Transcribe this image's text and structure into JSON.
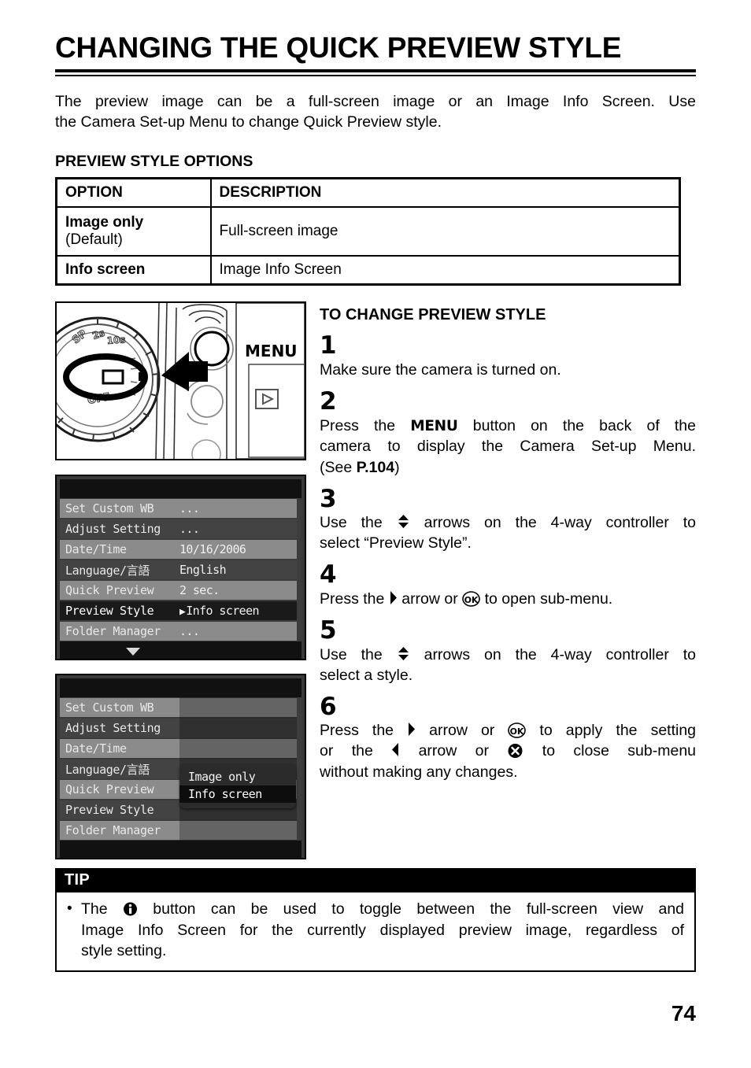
{
  "document": {
    "title": "CHANGING THE QUICK PREVIEW STYLE",
    "page_number": "74"
  },
  "intro": {
    "line1": "The preview image can be a full-screen image or an Image Info Screen.   Use",
    "line2": "the Camera Set-up Menu to change Quick Preview style."
  },
  "options_section": {
    "heading": "PREVIEW STYLE OPTIONS",
    "table": {
      "headers": [
        "OPTION",
        "DESCRIPTION"
      ],
      "rows": [
        {
          "option": "Image only",
          "option_sub": "(Default)",
          "description": "Full-screen image"
        },
        {
          "option": "Info screen",
          "option_sub": "",
          "description": "Image Info Screen"
        }
      ]
    }
  },
  "camera_figure": {
    "menu_label": "MENU",
    "dial_marks": [
      "SP",
      "2s",
      "10s",
      "OFF"
    ],
    "playback_icon": "play-triangle-icon",
    "callout": "arrow-pointing-to-menu-button"
  },
  "lcd_menu_1": {
    "rows": [
      {
        "label": "Set Custom WB",
        "value": "...",
        "band": "light",
        "selected": false
      },
      {
        "label": "Adjust Setting",
        "value": "...",
        "band": "dark",
        "selected": false
      },
      {
        "label": "Date/Time",
        "value": "10/16/2006",
        "band": "light",
        "selected": false
      },
      {
        "label": "Language/言語",
        "value": "English",
        "band": "dark",
        "selected": false
      },
      {
        "label": "Quick Preview",
        "value": "2 sec.",
        "band": "light",
        "selected": false
      },
      {
        "label": "Preview Style",
        "value": "Info screen",
        "band": "sel",
        "selected": true,
        "value_marker": "▶"
      },
      {
        "label": "Folder Manager",
        "value": "...",
        "band": "light",
        "selected": false
      }
    ],
    "scroll_indicator": "down-arrow-icon"
  },
  "lcd_menu_2": {
    "rows": [
      {
        "label": "Set Custom WB",
        "band": "light"
      },
      {
        "label": "Adjust Setting",
        "band": "dark"
      },
      {
        "label": "Date/Time",
        "band": "light"
      },
      {
        "label": "Language/言語",
        "band": "dark"
      },
      {
        "label": "Quick Preview",
        "band": "light"
      },
      {
        "label": "Preview Style",
        "band": "dark"
      },
      {
        "label": "Folder Manager",
        "band": "light"
      }
    ],
    "submenu": {
      "items": [
        {
          "label": "Image only",
          "selected": false
        },
        {
          "label": "Info screen",
          "selected": true
        }
      ]
    }
  },
  "procedure": {
    "heading": "TO CHANGE PREVIEW STYLE",
    "steps": [
      {
        "number": "1",
        "text": "Make sure the camera is turned on."
      },
      {
        "number": "2",
        "line1_a": "Press the",
        "keyword": "MENU",
        "line1_b": "button on the back of the",
        "line2": "camera to display the Camera Set-up Menu.",
        "line3_a": "(See",
        "line3_kw": "P.104",
        "line3_b": ")"
      },
      {
        "number": "3",
        "line1_a": "Use the",
        "line1_b": "arrows on the 4-way controller to",
        "line2": "select “Preview Style”."
      },
      {
        "number": "4",
        "line1_a": "Press the",
        "line1_b": "arrow or",
        "line1_c": "to open sub-menu."
      },
      {
        "number": "5",
        "line1_a": "Use the",
        "line1_b": "arrows on the 4-way controller to",
        "line2": "select a style."
      },
      {
        "number": "6",
        "line1_a": "Press the",
        "line1_b": "arrow or",
        "line1_c": "to apply the setting",
        "line2_a": "or the",
        "line2_b": "arrow or",
        "line2_c": "to close sub-menu",
        "line3": "without making any changes."
      }
    ]
  },
  "tip": {
    "header": "TIP",
    "bullet": "•",
    "line1_a": "The",
    "line1_b": "button can be used to toggle between the full-screen view and",
    "line2": "Image Info Screen for the currently displayed preview image, regardless of",
    "line3": "style setting."
  },
  "icons": {
    "updown": "up-down-arrows-icon",
    "right": "right-arrow-icon",
    "left": "left-arrow-icon",
    "ok": "ok-button-icon",
    "cancel": "cancel-x-button-icon",
    "info": "info-button-icon"
  }
}
